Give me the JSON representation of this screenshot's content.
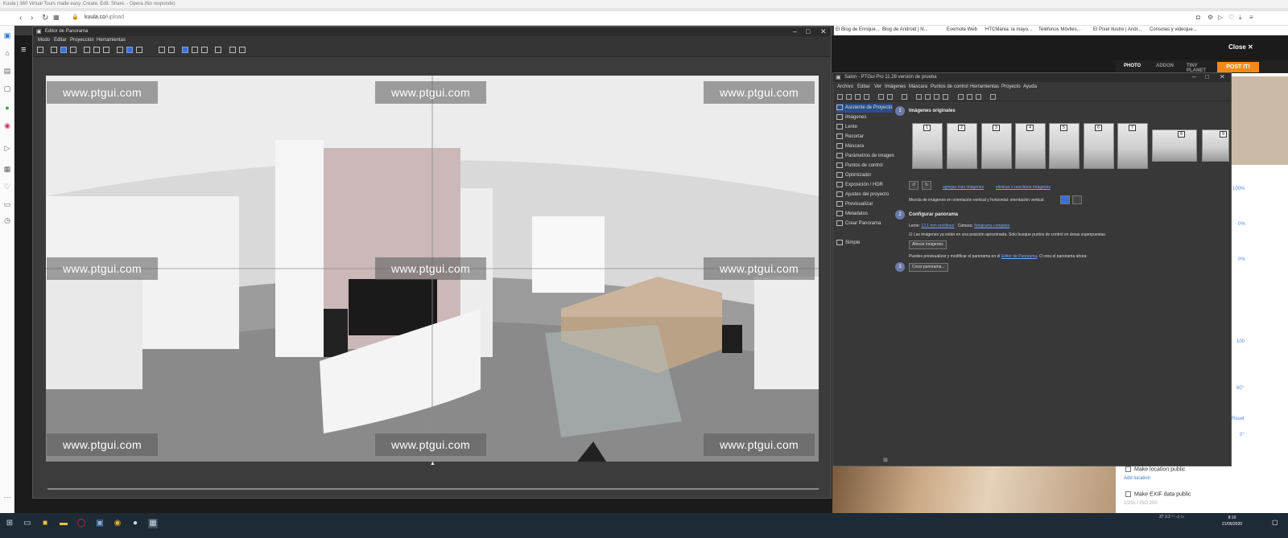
{
  "browser": {
    "title": "Kuula | 360 Virtual Tours made easy. Create. Edit. Share. - Opera (No responde)",
    "url_host": "kuula.co",
    "url_path": "/upload",
    "bookmarks": [
      "El Blog de Enrique...",
      "Blog de Android | N...",
      "Evernote Web",
      "HTCMania: la mayo...",
      "Teléfonos Móviles...",
      "El Píxel Ilustre | Andr...",
      "Consolas y videojue..."
    ]
  },
  "kuula": {
    "close_label": "Close",
    "tabs": [
      "PHOTO",
      "ADDON",
      "TINY PLANET"
    ],
    "post_button": "POST IT!",
    "side_values": [
      "100%",
      "0%",
      "0%",
      "100",
      "90°",
      "Reset",
      "0°"
    ],
    "location_checkbox": "Make location public",
    "add_location": "Add location",
    "exif_checkbox": "Make EXIF data public",
    "exposure": "1/20s / ISO 200"
  },
  "editor": {
    "title": "Editor de Panorama",
    "menu": [
      "Modo",
      "Editar",
      "Proyección",
      "Herramientas"
    ],
    "watermark": "www.ptgui.com"
  },
  "ptgui": {
    "title": "Salon - PTGui Pro 11.28 versión de prueba",
    "menu": [
      "Archivo",
      "Editar",
      "Ver",
      "Imágenes",
      "Máscara",
      "Puntos de control",
      "Herramientas",
      "Proyecto",
      "Ayuda"
    ],
    "nav": [
      "Asistente de Proyecto",
      "Imágenes",
      "Lente",
      "Recortar",
      "Máscara",
      "Parámetros de imagen",
      "Puntos de control",
      "Optimizador",
      "Exposición / HDR",
      "Ajustes del proyecto",
      "Previsualizar",
      "Metadatos",
      "Crear Panorama"
    ],
    "nav_simple": "Simple",
    "step1_label": "1",
    "step1_title": "Imágenes originales",
    "thumb_numbers": [
      "1",
      "2",
      "3",
      "4",
      "5",
      "6",
      "7",
      "8",
      "9"
    ],
    "link_add": "agregar más imágenes",
    "link_remove": "eliminar o reordenar imágenes",
    "mix_text": "Mezcla de imágenes en orientación vertical y horizontal: orientación vertical:",
    "step2_label": "2",
    "step2_title": "Configurar panorama",
    "lens_label": "Lente:",
    "lens_value": "12.1 mm rectilíneo",
    "camera_label": "Cámara:",
    "camera_value": "fotograma completo",
    "approx_text": "Las imágenes ya están en una posición aproximada. Solo busque puntos de control en áreas superpuestas.",
    "align_button": "Alinear imágenes",
    "preview_text_a": "Puedes previsualizar y modificar el panorama en el",
    "preview_link": "Editor de Panorama",
    "preview_text_b": ". O crea el panorama ahora:",
    "step3_label": "3",
    "create_button": "Crear panorama..."
  },
  "taskbar": {
    "tray_values": "37  3.2",
    "time": "8:10",
    "date": "21/05/2020"
  }
}
